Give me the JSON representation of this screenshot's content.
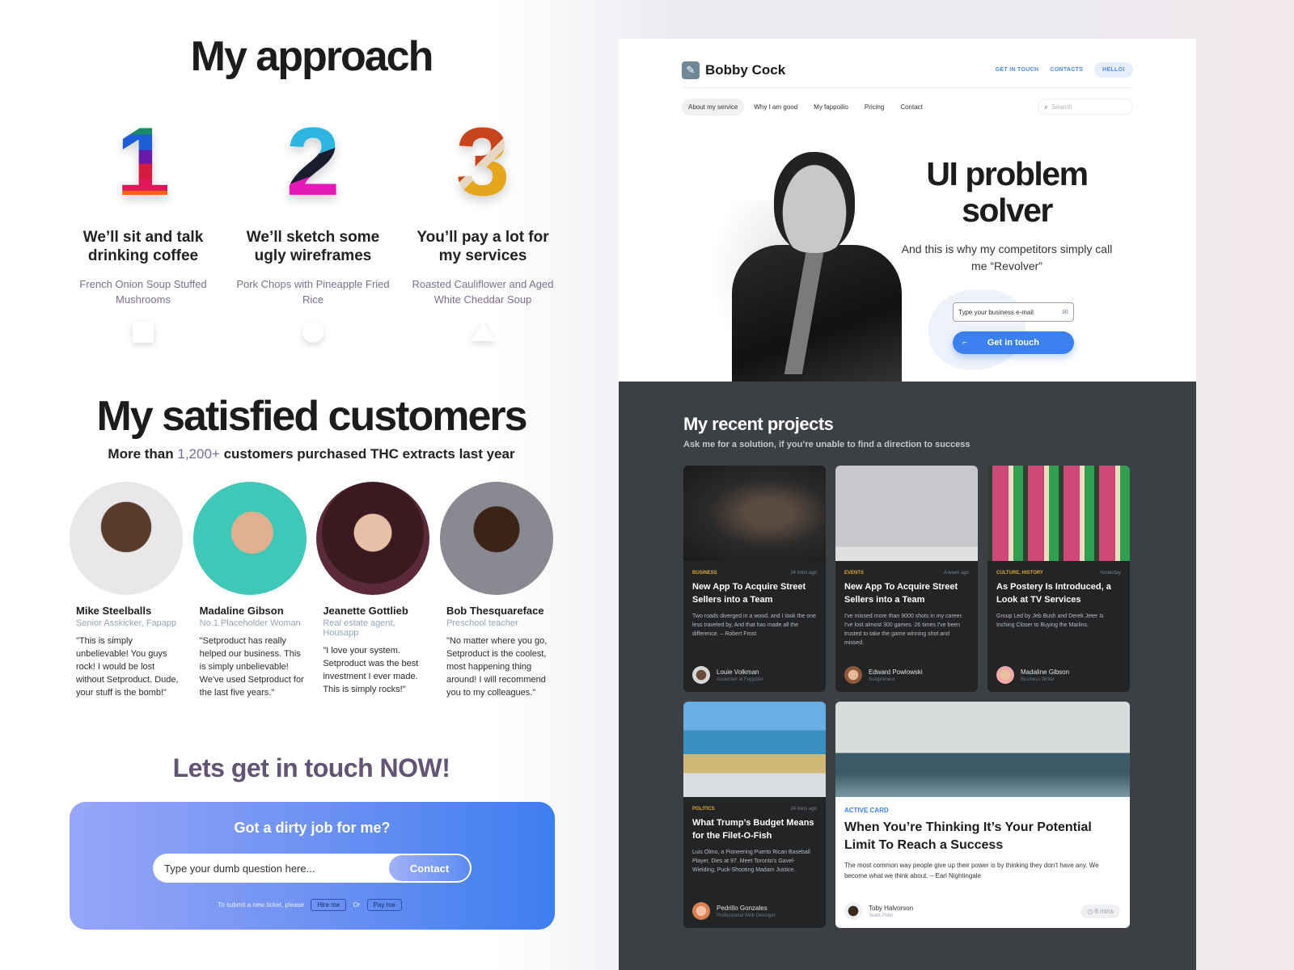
{
  "approach": {
    "title": "My approach",
    "steps": [
      {
        "number": "1",
        "title": "We’ll sit and talk drinking coffee",
        "subtitle": "French Onion Soup Stuffed Mushrooms",
        "shape": "square-icon"
      },
      {
        "number": "2",
        "title": "We’ll sketch some ugly wireframes",
        "subtitle": "Pork Chops with Pineapple Fried Rice",
        "shape": "circle-icon"
      },
      {
        "number": "3",
        "title": "You’ll pay a lot for my services",
        "subtitle": "Roasted Cauliflower and Aged White Cheddar Soup",
        "shape": "triangle-icon"
      }
    ]
  },
  "customers": {
    "title": "My satisfied customers",
    "subtitle_prefix": "More than ",
    "subtitle_highlight": "1,200+",
    "subtitle_suffix": " customers purchased THC extracts last year",
    "highlight_color": "#7a6ba0",
    "items": [
      {
        "name": "Mike Steelballs",
        "role": "Senior Asskicker, Fapapp",
        "quote": "\"This is simply unbelievable! You guys rock! I would be lost without Setproduct. Dude, your stuff is the bomb!\""
      },
      {
        "name": "Madaline Gibson",
        "role": "No.1 Placeholder Woman",
        "quote": "\"Setproduct has really helped our business. This is simply unbelievable! We've used Setproduct for the last five years.\""
      },
      {
        "name": "Jeanette Gottlieb",
        "role": "Real estate agent, Housapp",
        "quote": "\"I love your system. Setproduct was the best investment I ever made. This is simply rocks!\""
      },
      {
        "name": "Bob Thesquareface",
        "role": "Preschool teacher",
        "quote": "\"No matter where you go, Setproduct is the coolest, most happening thing around! I will recommend you to my colleagues.\""
      }
    ]
  },
  "contact": {
    "title": "Lets get in touch NOW!",
    "box_title": "Got a dirty job for me?",
    "input_placeholder": "Type your dumb question here...",
    "button_label": "Contact",
    "ticket_text": "To submit a new ticket, please",
    "hire_label": "Hire me",
    "or_label": "Or",
    "pay_label": "Pay me"
  },
  "site": {
    "brand": "Bobby Cock",
    "brand_icon": "pencil-icon",
    "top_links": [
      "GET IN TOUCH",
      "CONTACTS",
      "HELLO!"
    ],
    "nav": [
      "About my service",
      "Why I am good",
      "My fappoilio",
      "Pricing",
      "Contact"
    ],
    "active_nav": "About my service",
    "search_placeholder": "Search",
    "accent": "#3b7ff0",
    "hero": {
      "title": "UI problem solver",
      "subtitle": "And this is why my competitors simply call me “Revolver”",
      "email_placeholder": "Type your business e-mail",
      "button_label": "Get in touch"
    },
    "projects": {
      "title": "My recent projects",
      "subtitle": "Ask me for a solution, if you’re unable to find a direction to success",
      "cards": [
        {
          "category": "BUSINESS",
          "time": "24 mins ago",
          "title": "New App To Acquire Street Sellers into a Team",
          "desc": "Two roads diverged in a wood, and I took the one less traveled by, And that has made all the difference. – Robert Frost",
          "author": "Louie Volkman",
          "author_role": "Asskicker at Fappster"
        },
        {
          "category": "EVENTS",
          "time": "A week ago",
          "title": "New App To Acquire Street Sellers into a Team",
          "desc": "I've missed more than 9000 shots in my career. I've lost almost 300 games. 26 times I've been trusted to take the game winning shot and missed.",
          "author": "Edward Powlowski",
          "author_role": "Solopreneur"
        },
        {
          "category": "CULTURE, HISTORY",
          "time": "Yesterday",
          "title": "As Postery Is Introduced, a Look at TV Services",
          "desc": "Group Led by Jeb Bush and Derek Jeter Is Inching Closer to Buying the Marlins.",
          "author": "Madaline Gibson",
          "author_role": "Business Writer"
        },
        {
          "category": "POLITICS",
          "time": "24 mins ago",
          "title": "What Trump’s Budget Means for the Filet-O-Fish",
          "desc": "Luis Olmo, a Pioneering Puerto Rican Baseball Player, Dies at 97. Meet Toronto’s Gavel-Wielding, Puck-Shooting Madam Justice.",
          "author": "Pedrillo Gonzales",
          "author_role": "Professional Web Desinger"
        },
        {
          "category": "ACTIVE CARD",
          "time": "8 mins",
          "title": "When You’re Thinking It’s Your Potential Limit To Reach a Success",
          "desc": "The most common way people give up their power is by thinking they don’t have any. We become what we think about. – Earl Nightingale",
          "author": "Toby Halvorson",
          "author_role": "Team Pidor"
        }
      ]
    }
  }
}
